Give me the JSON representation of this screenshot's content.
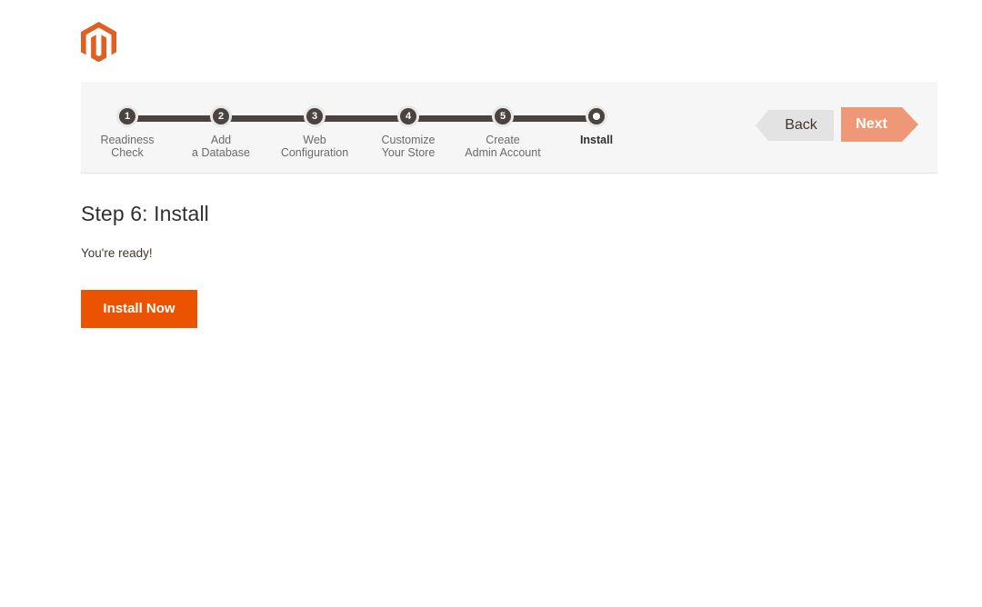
{
  "brand": {
    "logo_icon": "magento-logo-icon",
    "accent_color": "#eb5202"
  },
  "wizard": {
    "steps": [
      {
        "number": "1",
        "label": "Readiness\nCheck",
        "state": "done"
      },
      {
        "number": "2",
        "label": "Add\na Database",
        "state": "done"
      },
      {
        "number": "3",
        "label": "Web\nConfiguration",
        "state": "done"
      },
      {
        "number": "4",
        "label": "Customize\nYour Store",
        "state": "done"
      },
      {
        "number": "5",
        "label": "Create\nAdmin Account",
        "state": "done"
      },
      {
        "number": "6",
        "label": "Install",
        "state": "active"
      }
    ],
    "back_label": "Back",
    "next_label": "Next"
  },
  "main": {
    "title": "Step 6: Install",
    "ready_text": "You're ready!",
    "install_label": "Install Now"
  },
  "colors": {
    "step_bar": "#4b4340",
    "next_button": "#ef9877",
    "back_button": "#e3e3e3",
    "install_button": "#eb5202",
    "panel_background": "#f6f6f6"
  }
}
